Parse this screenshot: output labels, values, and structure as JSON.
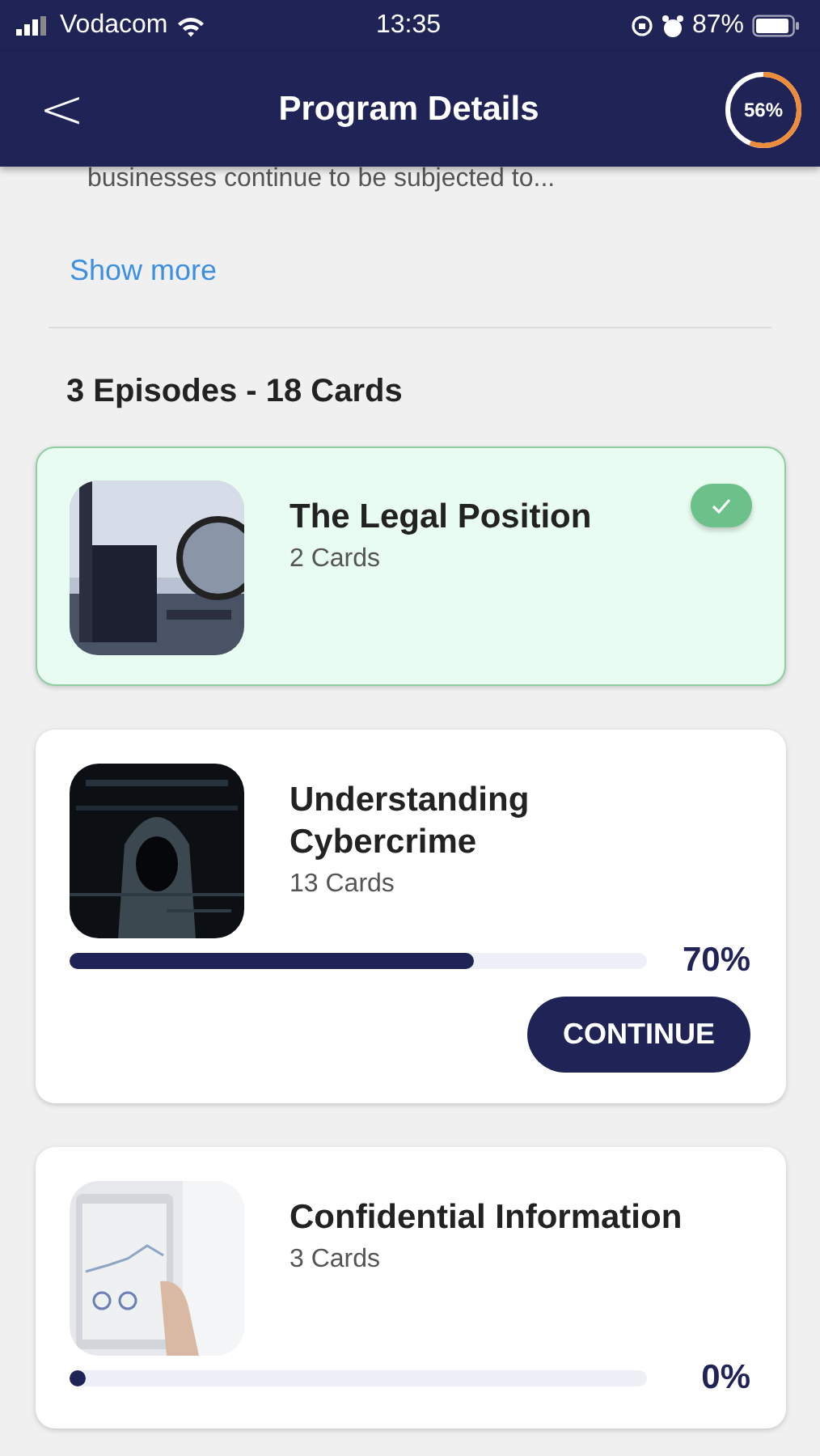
{
  "status_bar": {
    "carrier": "Vodacom",
    "time": "13:35",
    "battery": "87%"
  },
  "header": {
    "title": "Program Details",
    "back": "<",
    "progress": {
      "level": 0.56,
      "label": "56%"
    }
  },
  "description": {
    "text": "businesses continue to be subjected to...",
    "link": "Show more"
  },
  "summary": "3 Episodes - 18 Cards",
  "episodes": [
    {
      "title": "The Legal Position",
      "cards": "2 Cards",
      "completed": true
    },
    {
      "title": "Understanding Cybercrime",
      "cards": "13 Cards",
      "completed": false,
      "level": 0.7,
      "percent": "70%",
      "button": "CONTINUE"
    },
    {
      "title": "Confidential Information",
      "cards": "3 Cards",
      "completed": false,
      "level": 0,
      "percent": "0%"
    }
  ]
}
